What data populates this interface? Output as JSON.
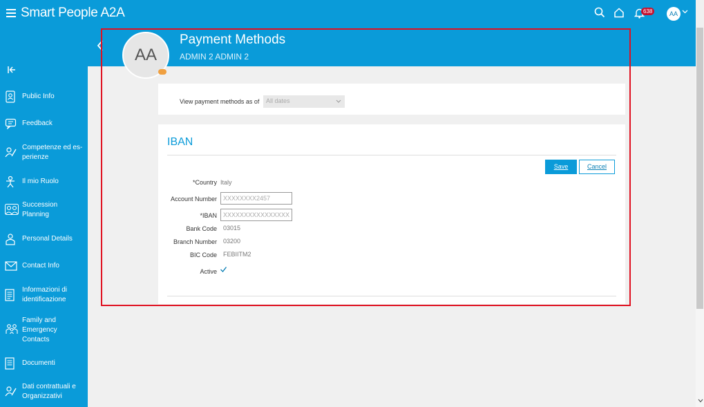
{
  "app": {
    "logo_text": "Smart People A2A",
    "notifications_count": "638",
    "user_initials": "AA"
  },
  "colors": {
    "brand": "#0a9bd9",
    "badge": "#c41230",
    "highlight": "#e01020"
  },
  "sidebar": {
    "items": [
      {
        "label": "Public Info",
        "icon": "id-card-icon"
      },
      {
        "label": "Feedback",
        "icon": "feedback-icon"
      },
      {
        "label": "Competenze ed es-perienze",
        "icon": "skills-icon"
      },
      {
        "label": "Il mio Ruolo",
        "icon": "role-icon"
      },
      {
        "label": "Succession Planning",
        "icon": "succession-icon"
      },
      {
        "label": "Personal Details",
        "icon": "person-icon"
      },
      {
        "label": "Contact Info",
        "icon": "mail-icon"
      },
      {
        "label": "Informazioni di identificazione",
        "icon": "document-icon"
      },
      {
        "label": "Family and Emergency Contacts",
        "icon": "family-icon"
      },
      {
        "label": "Documenti",
        "icon": "document-icon"
      },
      {
        "label": "Dati contrattuali e Organizzativi",
        "icon": "contract-icon"
      }
    ]
  },
  "header": {
    "avatar_initials": "AA",
    "title": "Payment Methods",
    "subtitle": "ADMIN 2 ADMIN 2"
  },
  "filter": {
    "label": "View payment methods as of",
    "selected": "All dates"
  },
  "iban_section": {
    "title": "IBAN",
    "save_label": "Save",
    "cancel_label": "Cancel",
    "fields": {
      "country_label": "*Country",
      "country_value": "Italy",
      "account_number_label": "Account Number",
      "account_number_value": "XXXXXXXX2457",
      "iban_label": "*IBAN",
      "iban_value": "XXXXXXXXXXXXXXXXXXXXXXX",
      "bank_code_label": "Bank Code",
      "bank_code_value": "03015",
      "branch_number_label": "Branch Number",
      "branch_number_value": "03200",
      "bic_code_label": "BIC Code",
      "bic_code_value": "FEBIITM2",
      "active_label": "Active",
      "active_checked": true
    }
  }
}
